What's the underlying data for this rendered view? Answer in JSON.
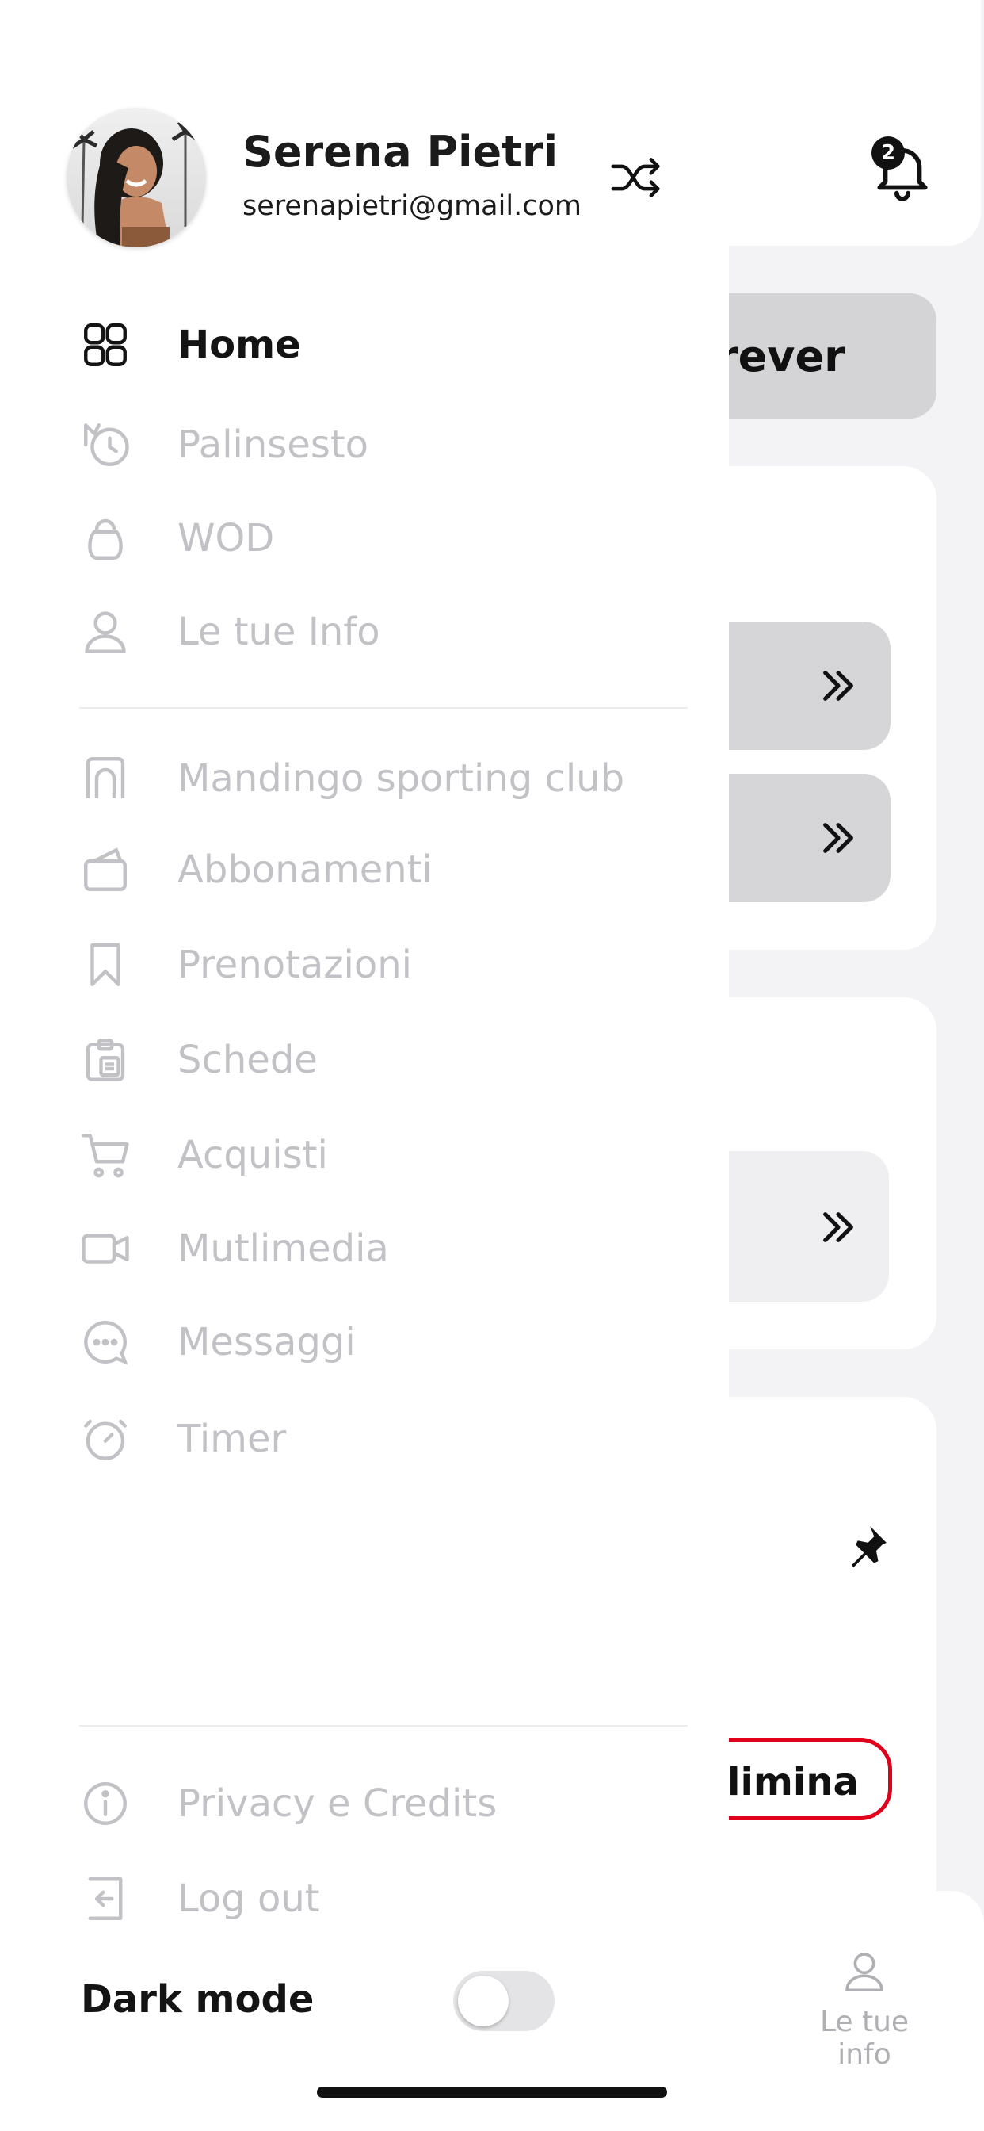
{
  "background": {
    "notifications_count": "2",
    "pill_text": "rever",
    "delete_text": "limina",
    "bottom_nav": {
      "user_label": "Le tue info"
    }
  },
  "drawer": {
    "user": {
      "name": "Serena Pietri",
      "email": "serenapietri@gmail.com"
    },
    "menu_primary": [
      {
        "label": "Home",
        "icon": "grid-icon",
        "active": true
      },
      {
        "label": "Palinsesto",
        "icon": "schedule-history-icon"
      },
      {
        "label": "WOD",
        "icon": "kettlebell-icon"
      },
      {
        "label": "Le tue Info",
        "icon": "user-icon"
      }
    ],
    "menu_secondary": [
      {
        "label": "Mandingo sporting club",
        "icon": "building-icon"
      },
      {
        "label": "Abbonamenti",
        "icon": "subscription-icon"
      },
      {
        "label": "Prenotazioni",
        "icon": "bookmark-icon"
      },
      {
        "label": "Schede",
        "icon": "clipboard-icon"
      },
      {
        "label": "Acquisti",
        "icon": "cart-icon"
      },
      {
        "label": "Mutlimedia",
        "icon": "video-icon"
      },
      {
        "label": "Messaggi",
        "icon": "chat-icon"
      },
      {
        "label": "Timer",
        "icon": "stopwatch-icon"
      }
    ],
    "menu_footer": [
      {
        "label": "Privacy e Credits",
        "icon": "info-icon"
      },
      {
        "label": "Log out",
        "icon": "logout-icon"
      }
    ],
    "dark_mode": {
      "label": "Dark mode",
      "enabled": false
    }
  }
}
